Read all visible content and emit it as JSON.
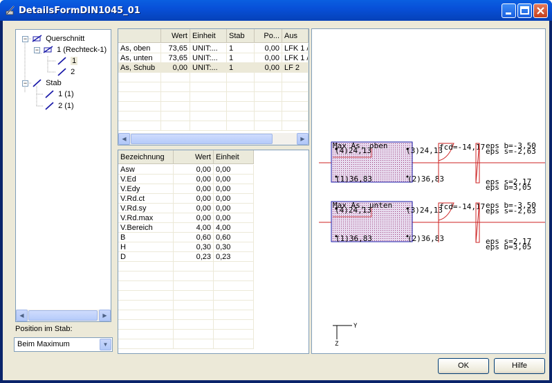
{
  "window": {
    "title": "DetailsFormDIN1045_01"
  },
  "tree": {
    "items": [
      {
        "label": "Querschnitt"
      },
      {
        "label": "1 (Rechteck-1)"
      },
      {
        "label": "1"
      },
      {
        "label": "2"
      },
      {
        "label": "Stab"
      },
      {
        "label": "1 (1)"
      },
      {
        "label": "2 (1)"
      }
    ]
  },
  "position": {
    "label": "Position im Stab:",
    "selected": "Beim Maximum"
  },
  "top_grid": {
    "columns": [
      "",
      "Wert",
      "Einheit",
      "Stab",
      "Po...",
      "Aus"
    ],
    "rows": [
      [
        "As, oben",
        "73,65",
        "UNIT:...",
        "1",
        "0,00",
        "LFK 1 /"
      ],
      [
        "As, unten",
        "73,65",
        "UNIT:...",
        "1",
        "0,00",
        "LFK 1 /"
      ],
      [
        "As, Schub",
        "0,00",
        "UNIT:...",
        "1",
        "0,00",
        "LF 2"
      ]
    ]
  },
  "bottom_grid": {
    "columns": [
      "Bezeichnung",
      "Wert",
      "Einheit"
    ],
    "rows": [
      [
        "Asw",
        "0,00",
        "0,00"
      ],
      [
        "V.Ed",
        "0,00",
        "0,00"
      ],
      [
        "V.Edy",
        "0,00",
        "0,00"
      ],
      [
        "V.Rd.ct",
        "0,00",
        "0,00"
      ],
      [
        "V.Rd.sy",
        "0,00",
        "0,00"
      ],
      [
        "V.Rd.max",
        "0,00",
        "0,00"
      ],
      [
        "V.Bereich",
        "4,00",
        "4,00"
      ],
      [
        "B",
        "0,60",
        "0,60"
      ],
      [
        "H",
        "0,30",
        "0,30"
      ],
      [
        "D",
        "0,23",
        "0,23"
      ]
    ]
  },
  "drawing": {
    "sections": [
      {
        "title": "Max As, oben",
        "p4": "(4)24,13",
        "p3": "(3)24,13",
        "p1": "(1)36,83",
        "p2": "(2)36,83",
        "fcd": "fcd=-14,17",
        "eps_b_top": "eps b=-3,50",
        "eps_s_top": "eps s=-2,63",
        "eps_s_bot": "eps s=2,17",
        "eps_b_bot": "eps b=3,05"
      },
      {
        "title": "Max As, unten",
        "p4": "(4)24,13",
        "p3": "(3)24,13",
        "p1": "(1)36,83",
        "p2": "(2)36,83",
        "fcd": "fcd=-14,17",
        "eps_b_top": "eps b=-3,50",
        "eps_s_top": "eps s=-2,63",
        "eps_s_bot": "eps s=2,17",
        "eps_b_bot": "eps b=3,05"
      }
    ],
    "axis_y": "Y",
    "axis_z": "Z"
  },
  "buttons": {
    "ok": "OK",
    "help": "Hilfe"
  },
  "colors": {
    "section_fill": "#6a2a8a",
    "section_outline": "#1a1aa8",
    "stress": "#cc2222"
  }
}
